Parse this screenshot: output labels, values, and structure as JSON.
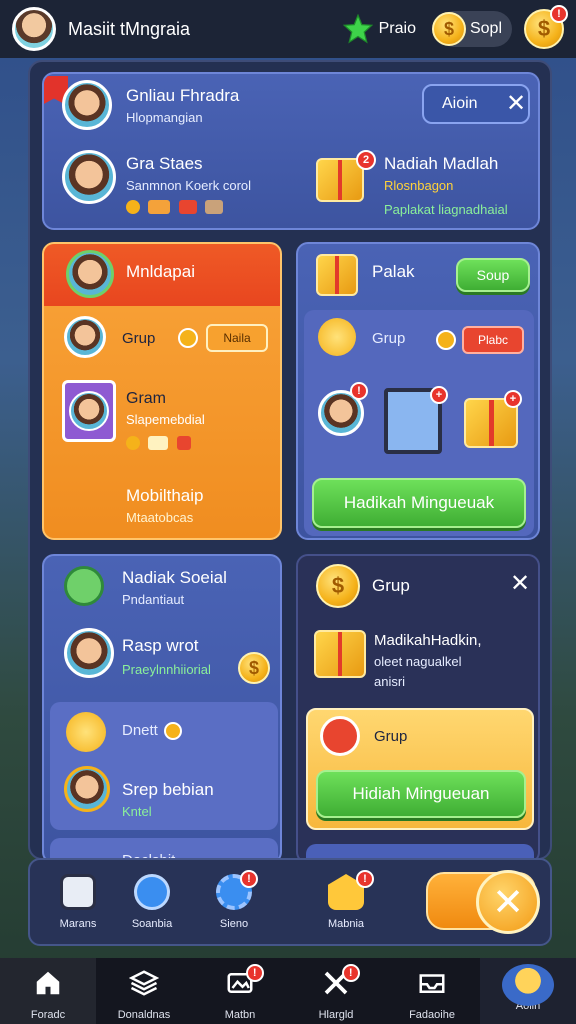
{
  "topbar": {
    "title": "Masiit tMngraia",
    "stars_label": "Praio",
    "coins_value": "Sopl",
    "coin_symbol": "$",
    "notif_badge": "!"
  },
  "card1": {
    "title": "Gnliau Fhradra",
    "subtitle": "Hlopmangian",
    "action_button": "Aioin",
    "user_name": "Gra Staes",
    "user_desc": "Sanmnon Koerk corol",
    "gift_badge": "2",
    "reward_title": "Nadiah Madlah",
    "reward_sub": "Rlosnbagon",
    "reward_green": "Paplakat liagnadhaial"
  },
  "card_orange": {
    "title": "Mnldapai",
    "row1_label": "Grup",
    "row1_button": "Naila",
    "row2_title": "Gram",
    "row2_sub": "Slapemebdial",
    "row3_title": "Mobilthaip",
    "row3_sub": "Mtaatobcas"
  },
  "card_blue_right": {
    "title": "Palak",
    "sub_button": "Soup",
    "row_label": "Grup",
    "row_button": "Plabc",
    "claim_button": "Hadikah Mingueuak"
  },
  "card_social": {
    "title": "Nadiak Soeial",
    "subtitle": "Pndantiaut",
    "row1_title": "Rasp wrot",
    "row1_green": "Praeylnnhiiorial",
    "row2_title": "Dnett",
    "row3_title": "Srep bebian",
    "row3_sub": "Kntel",
    "row4_title": "Daclsbit"
  },
  "card_grup": {
    "title": "Grup",
    "desc_line1": "MadikahHadkin,",
    "desc_line2": "oleet nagualkel",
    "desc_line3": "anisri",
    "inner_label": "Grup",
    "claim_button": "Hidiah Mingueuan"
  },
  "actionbar": {
    "items": [
      {
        "label": "Marans",
        "badge": ""
      },
      {
        "label": "Soanbia",
        "badge": ""
      },
      {
        "label": "Sieno",
        "badge": "!"
      },
      {
        "label": "Mabnia",
        "badge": "!"
      }
    ],
    "toggle_symbol": "✕"
  },
  "bottomnav": {
    "items": [
      {
        "label": "Foradc"
      },
      {
        "label": "Donaldnas"
      },
      {
        "label": "Matbn"
      },
      {
        "label": "Hlargld"
      },
      {
        "label": "Fadaoihe"
      },
      {
        "label": "Aolin"
      }
    ]
  }
}
